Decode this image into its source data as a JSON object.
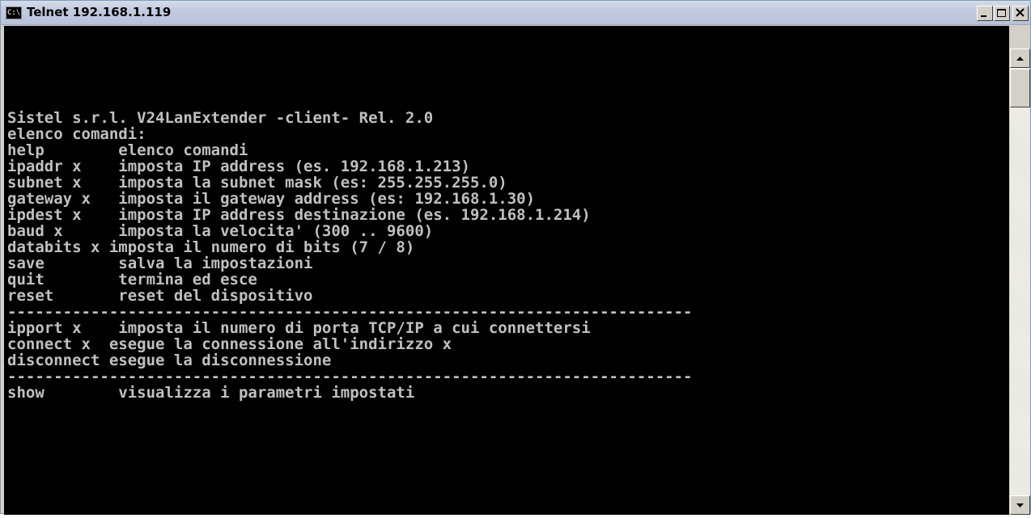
{
  "window": {
    "title": "Telnet 192.168.1.119",
    "icon_label": "C:\\"
  },
  "icons": {
    "app": "console-icon",
    "minimize": "minimize-icon",
    "maximize": "maximize-icon",
    "close": "close-icon",
    "scroll_up": "arrow-up-icon",
    "scroll_down": "arrow-down-icon"
  },
  "colors": {
    "console_background": "#000000",
    "console_text": "#c0c0c0"
  },
  "console": {
    "lines": [
      "Sistel s.r.l. V24LanExtender -client- Rel. 2.0",
      "elenco comandi:",
      "help        elenco comandi",
      "ipaddr x    imposta IP address (es. 192.168.1.213)",
      "subnet x    imposta la subnet mask (es: 255.255.255.0)",
      "gateway x   imposta il gateway address (es: 192.168.1.30)",
      "ipdest x    imposta IP address destinazione (es. 192.168.1.214)",
      "baud x      imposta la velocita' (300 .. 9600)",
      "databits x imposta il numero di bits (7 / 8)",
      "save        salva la impostazioni",
      "quit        termina ed esce",
      "reset       reset del dispositivo",
      "--------------------------------------------------------------------------",
      "ipport x    imposta il numero di porta TCP/IP a cui connettersi",
      "connect x  esegue la connessione all'indirizzo x",
      "disconnect esegue la disconnessione",
      "--------------------------------------------------------------------------",
      "show        visualizza i parametri impostati"
    ]
  }
}
